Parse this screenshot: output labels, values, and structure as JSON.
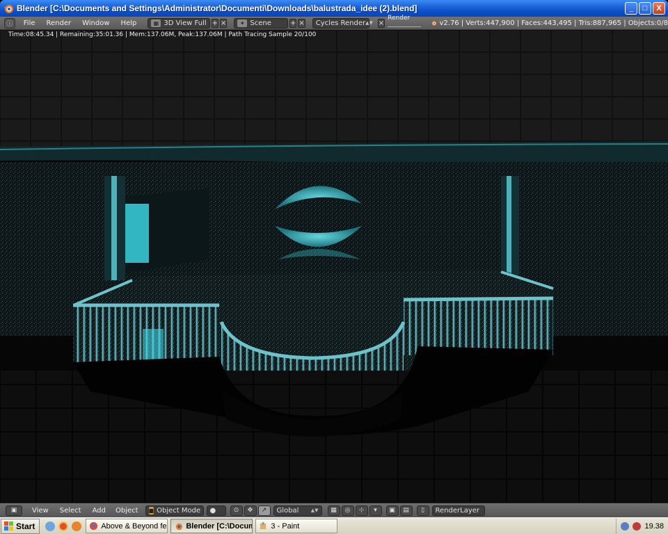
{
  "window": {
    "title": "Blender [C:\\Documents and Settings\\Administrator\\Documenti\\Downloads\\balustrada_idee (2).blend]",
    "minimize_label": "_",
    "maximize_label": "□",
    "close_label": "X"
  },
  "header": {
    "menus": [
      "File",
      "Render",
      "Window",
      "Help"
    ],
    "screen_layout": "3D View Full",
    "scene": "Scene",
    "render_engine": "Cycles Render",
    "render_progress_label": "Render",
    "stats": "v2.76 | Verts:447,900 | Faces:443,495 | Tris:887,965 | Objects:0/8"
  },
  "viewport": {
    "render_info": "Time:08:45.34 | Remaining:35:01.36 | Mem:137.06M, Peak:137.06M | Path Tracing Sample 20/100",
    "accent_color": "#3fd6e6"
  },
  "view_header": {
    "menus": [
      "View",
      "Select",
      "Add",
      "Object"
    ],
    "mode": "Object Mode",
    "orientation": "Global",
    "render_layer": "RenderLayer"
  },
  "taskbar": {
    "start_label": "Start",
    "tasks": [
      "Above & Beyond fea...",
      "Blender [C:\\Docum...",
      "3 - Paint"
    ],
    "clock": "19.38"
  }
}
